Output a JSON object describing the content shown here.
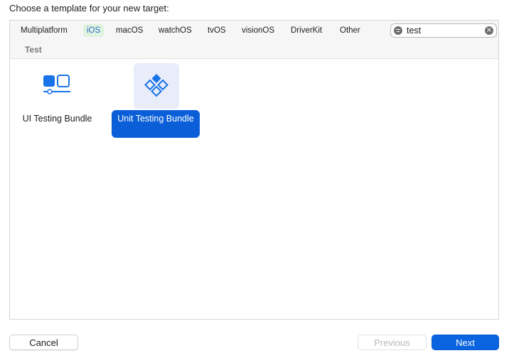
{
  "dialog": {
    "heading": "Choose a template for your new target:"
  },
  "platform_tabs": [
    {
      "label": "Multiplatform",
      "active": false
    },
    {
      "label": "iOS",
      "active": true
    },
    {
      "label": "macOS",
      "active": false
    },
    {
      "label": "watchOS",
      "active": false
    },
    {
      "label": "tvOS",
      "active": false
    },
    {
      "label": "visionOS",
      "active": false
    },
    {
      "label": "DriverKit",
      "active": false
    },
    {
      "label": "Other",
      "active": false
    }
  ],
  "search": {
    "value": "test",
    "filter_icon": "filter-icon",
    "clear_icon": "clear-icon"
  },
  "section": {
    "title": "Test"
  },
  "templates": [
    {
      "label": "UI Testing Bundle",
      "icon": "ui-testing-bundle-icon",
      "selected": false
    },
    {
      "label": "Unit Testing Bundle",
      "icon": "unit-testing-bundle-icon",
      "selected": true
    }
  ],
  "footer": {
    "cancel_label": "Cancel",
    "previous_label": "Previous",
    "next_label": "Next"
  },
  "colors": {
    "accent": "#0a64e0",
    "icon_blue": "#1a73e8",
    "selection_background": "#e8edf9",
    "active_tab_background": "#dff3de",
    "active_tab_text": "#2b6cd2"
  }
}
